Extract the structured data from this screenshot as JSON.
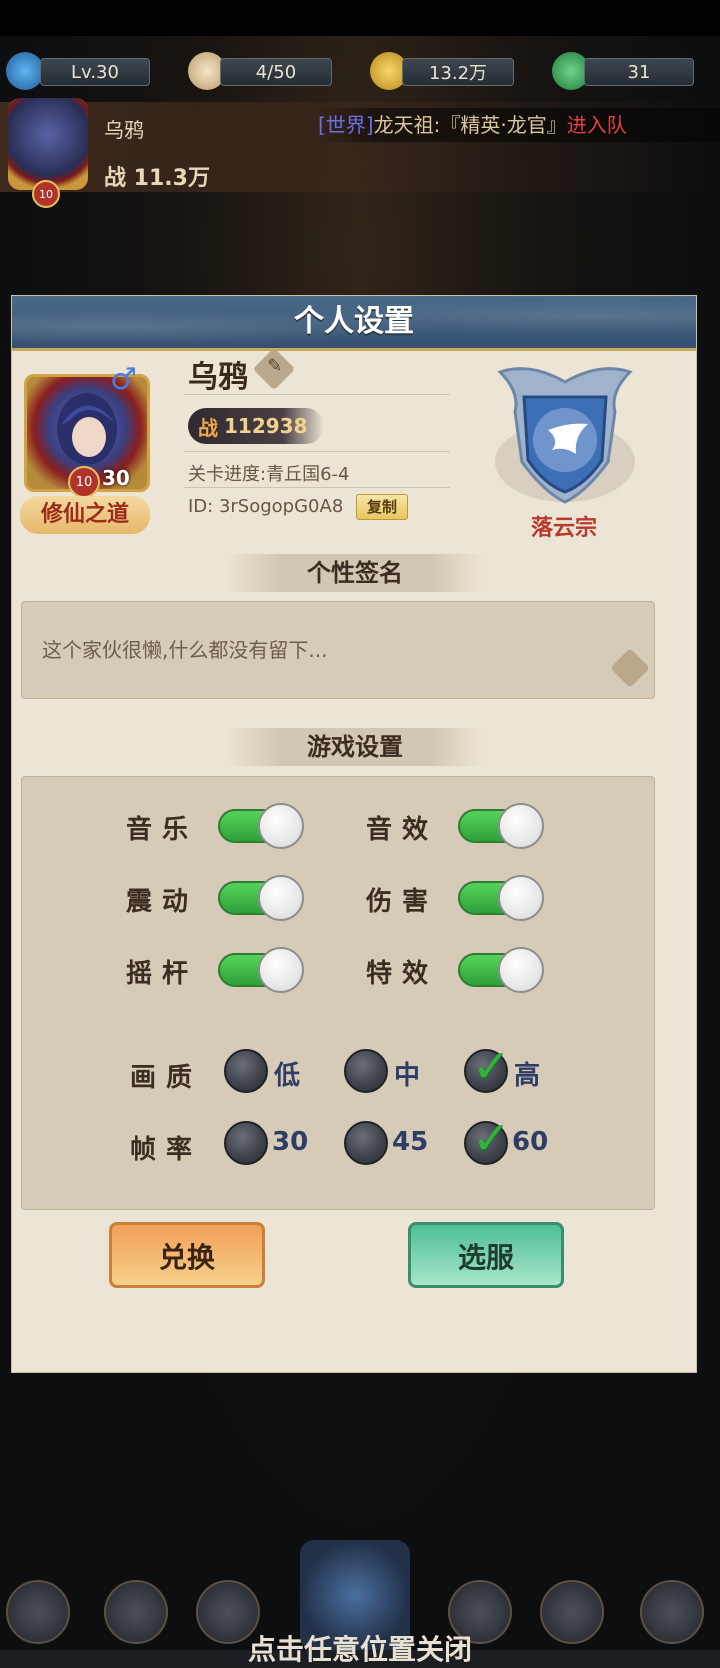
{
  "hud": {
    "level": "Lv.30",
    "stamina": "4/50",
    "coins": "13.2万",
    "jade": "31",
    "player_name": "乌鸦",
    "power": "战 11.3万",
    "avatar_level": "10",
    "world_tag": "[世界]",
    "world_message": "龙天祖:『精英·龙官』",
    "world_link": "进入队"
  },
  "dialog": {
    "title": "个人设置",
    "profile": {
      "name": "乌鸦",
      "gender_symbol": "♂",
      "avatar_level": "10",
      "avatar_stars": "30",
      "path_badge": "修仙之道",
      "power_prefix": "战",
      "power_value": "112938",
      "stage": "关卡进度:青丘国6-4",
      "id": "ID: 3rSogopG0A8",
      "copy_label": "复制",
      "sect_name": "落云宗"
    },
    "signature": {
      "heading": "个性签名",
      "text": "这个家伙很懒,什么都没有留下..."
    },
    "game_settings": {
      "heading": "游戏设置",
      "toggles": [
        {
          "label": "音乐",
          "on": true
        },
        {
          "label": "音效",
          "on": true
        },
        {
          "label": "震动",
          "on": true
        },
        {
          "label": "伤害",
          "on": true
        },
        {
          "label": "摇杆",
          "on": true
        },
        {
          "label": "特效",
          "on": true
        }
      ],
      "quality": {
        "label": "画质",
        "options": [
          "低",
          "中",
          "高"
        ],
        "selected": "高"
      },
      "framerate": {
        "label": "帧率",
        "options": [
          "30",
          "45",
          "60"
        ],
        "selected": "60"
      }
    },
    "buttons": {
      "exchange": "兑换",
      "select_server": "选服"
    }
  },
  "footer": {
    "close_hint": "点击任意位置关闭"
  },
  "colors": {
    "accent_green": "#2fa03a",
    "title_bar": "#34506e",
    "sect_red": "#b83a2c"
  }
}
